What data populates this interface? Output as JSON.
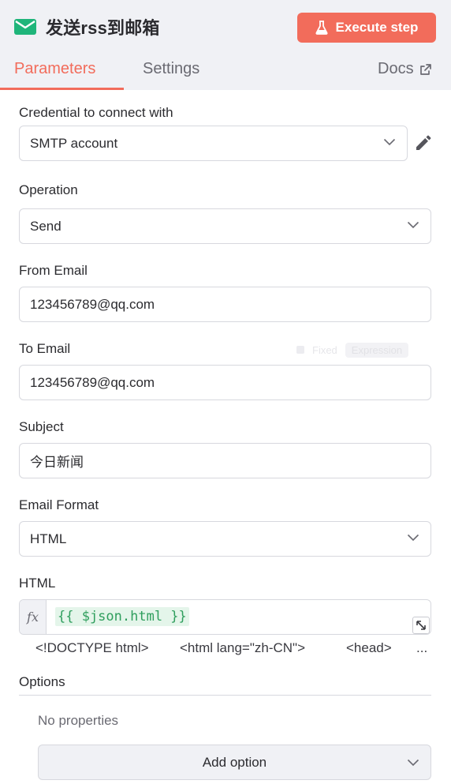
{
  "header": {
    "title": "发送rss到邮箱",
    "execute_label": "Execute step",
    "tabs": {
      "parameters": "Parameters",
      "settings": "Settings",
      "docs": "Docs"
    }
  },
  "fields": {
    "credential": {
      "label": "Credential to connect with",
      "value": "SMTP account"
    },
    "operation": {
      "label": "Operation",
      "value": "Send"
    },
    "from_email": {
      "label": "From Email",
      "value": "123456789@qq.com"
    },
    "to_email": {
      "label": "To Email",
      "value": "123456789@qq.com",
      "toggle_fixed": "Fixed",
      "toggle_expression": "Expression"
    },
    "subject": {
      "label": "Subject",
      "value": "今日新闻"
    },
    "email_format": {
      "label": "Email Format",
      "value": "HTML"
    },
    "html": {
      "label": "HTML",
      "fx": "fx",
      "expression": "{{ $json.html }}",
      "preview": [
        "<!DOCTYPE html>",
        "<html lang=\"zh-CN\">",
        "<head>",
        "..."
      ]
    }
  },
  "options": {
    "label": "Options",
    "empty_text": "No properties",
    "add_label": "Add option"
  },
  "colors": {
    "accent": "#f26c5b",
    "node_icon": "#1fb57a",
    "expression_text": "#2f9e5d",
    "expression_bg": "#e4f5ea"
  },
  "icons": {
    "node": "envelope-icon",
    "execute": "flask-icon",
    "docs": "external-link-icon",
    "edit": "pencil-icon",
    "dropdown": "chevron-down-icon"
  }
}
